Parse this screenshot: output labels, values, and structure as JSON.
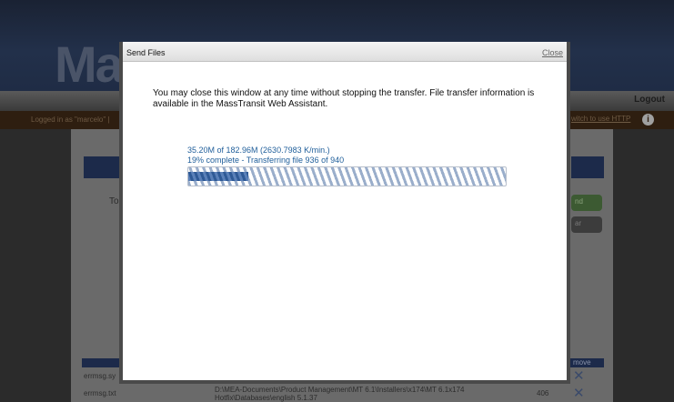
{
  "background": {
    "logo_fragment": "Ma",
    "logout_label": "Logout",
    "logged_in_text": "Logged in as \"marcelo\" |",
    "http_link": "witch to use HTTP",
    "to_label": "To",
    "green_button_label": "nd",
    "gray_button_label": "ar",
    "remove_header": "move",
    "rows": [
      {
        "name": "errmsg.sy",
        "path": "",
        "size": ""
      },
      {
        "name": "errmsg.txt",
        "path": "D:\\MEA-Documents\\Product Management\\MT 6.1\\Installers\\x174\\MT 6.1x174 Hotfix\\Databases\\english 5.1.37",
        "size": "406"
      }
    ]
  },
  "modal": {
    "title": "Send Files",
    "close_label": "Close",
    "message": "You may close this window at any time without stopping the transfer. File transfer information is available in the MassTransit Web Assistant.",
    "stats_line1": "35.20M of 182.96M (2630.7983 K/min.)",
    "stats_line2": "19% complete - Transferring file 936 of 940",
    "progress_fraction": 0.19
  },
  "colors": {
    "accent": "#1f5e9a",
    "progress_fill": "#2f5a96"
  }
}
